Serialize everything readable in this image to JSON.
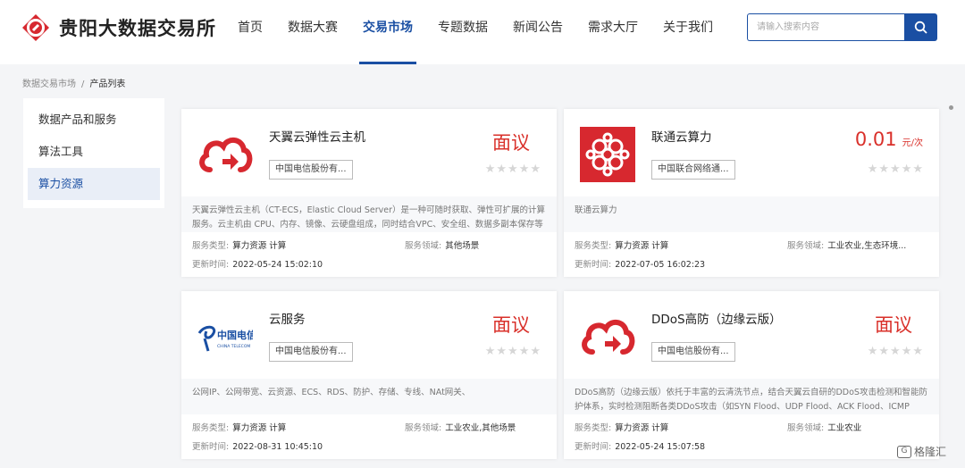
{
  "header": {
    "logo_text": "贵阳大数据交易所",
    "nav": [
      "首页",
      "数据大赛",
      "交易市场",
      "专题数据",
      "新闻公告",
      "需求大厅",
      "关于我们"
    ],
    "active_nav": "交易市场",
    "search_placeholder": "请输入搜索内容"
  },
  "breadcrumb": {
    "parent": "数据交易市场",
    "separator": "/",
    "current": "产品列表"
  },
  "sidebar": {
    "items": [
      {
        "label": "数据产品和服务",
        "active": false
      },
      {
        "label": "算法工具",
        "active": false
      },
      {
        "label": "算力资源",
        "active": true
      }
    ]
  },
  "labels": {
    "service_type": "服务类型:",
    "service_domain": "服务领域:",
    "update_time": "更新时间:"
  },
  "products": [
    {
      "title": "天翼云弹性云主机",
      "provider": "中国电信股份有...",
      "price": "面议",
      "unit": "",
      "rating": 0,
      "thumb_icon": "red-cloud-icon",
      "description": "天翼云弹性云主机（CT-ECS，Elastic Cloud Server）是一种可随时获取、弹性可扩展的计算服务。云主机由 CPU、内存、镜像、云硬盘组成，同时结合VPC、安全组、数据多副本保存等能力，打造一个既高效又可靠安全的计算环境，确保服务持久",
      "service_type": "算力资源 计算",
      "service_domain": "其他场景",
      "update_time": "2022-05-24 15:02:10"
    },
    {
      "title": "联通云算力",
      "provider": "中国联合网络通...",
      "price": "0.01",
      "unit": "元/次",
      "rating": 0,
      "thumb_icon": "china-unicom-logo-icon",
      "description": "联通云算力",
      "service_type": "算力资源 计算",
      "service_domain": "工业农业,生态环境...",
      "update_time": "2022-07-05 16:02:23"
    },
    {
      "title": "云服务",
      "provider": "中国电信股份有...",
      "price": "面议",
      "unit": "",
      "rating": 0,
      "thumb_icon": "china-telecom-logo-icon",
      "description": "公网IP、公网带宽、云资源、ECS、RDS、防护、存储、专线、NAt网关、",
      "service_type": "算力资源 计算",
      "service_domain": "工业农业,其他场景",
      "update_time": "2022-08-31 10:45:10"
    },
    {
      "title": "DDoS高防（边缘云版）",
      "provider": "中国电信股份有...",
      "price": "面议",
      "unit": "",
      "rating": 0,
      "thumb_icon": "red-cloud-icon",
      "description": "DDoS高防（边缘云版）依托于丰富的云清洗节点，结合天翼云自研的DDoS攻击检测和智能防护体系，实时检测阻断各类DDoS攻击（如SYN Flood、UDP Flood、ACK Flood、ICMP Flood、DNS Query Flood、NTP reply Flood等）",
      "service_type": "算力资源 计算",
      "service_domain": "工业农业",
      "update_time": "2022-05-24 15:07:58"
    }
  ],
  "watermark": {
    "mark": "G",
    "text": "格隆汇"
  },
  "colors": {
    "brand_blue": "#1a4fa3",
    "price_red": "#d9302a",
    "logo_red": "#d7282f"
  }
}
